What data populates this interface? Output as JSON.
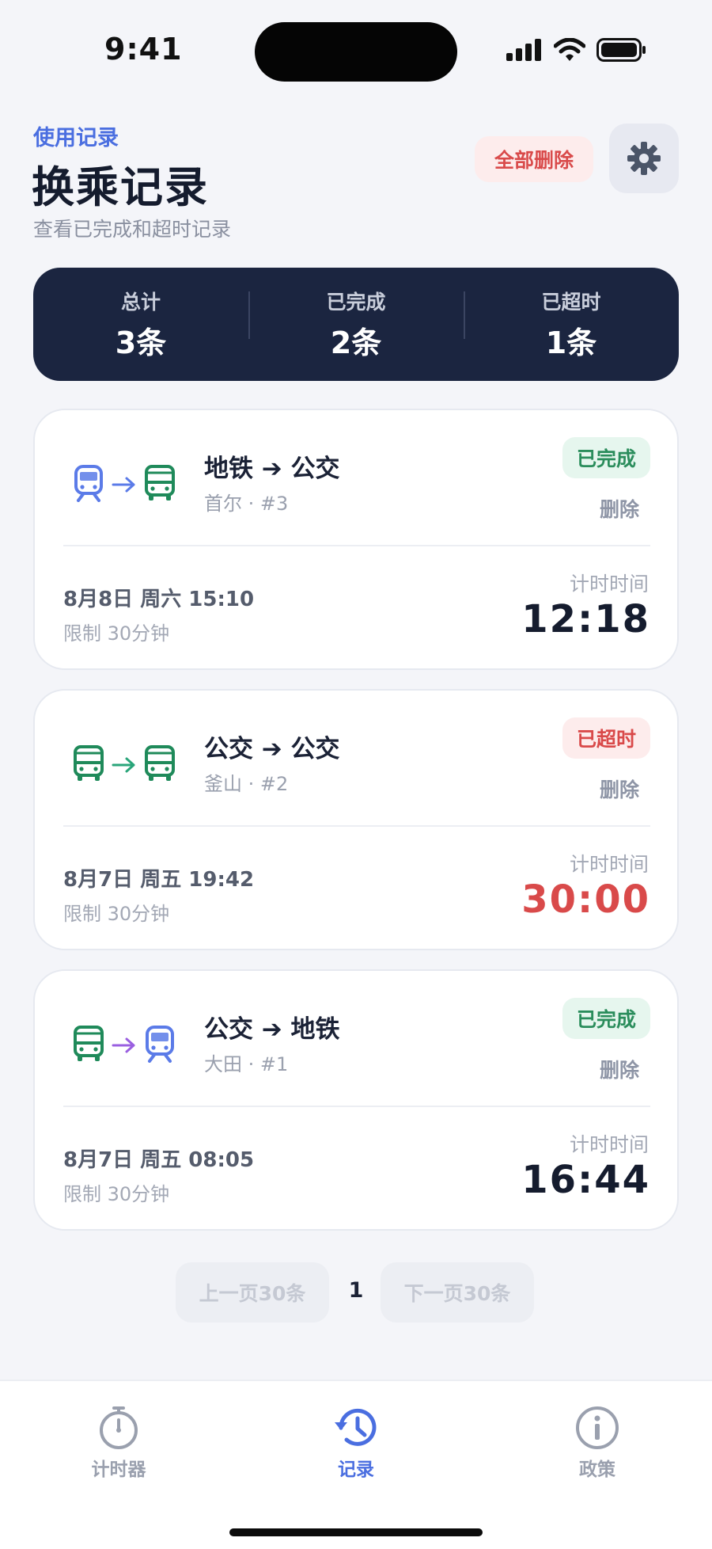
{
  "status": {
    "time": "9:41"
  },
  "header": {
    "eyebrow": "使用记录",
    "title": "换乘记录",
    "subtitle": "查看已完成和超时记录",
    "delete_all": "全部删除"
  },
  "summary": [
    {
      "label": "总计",
      "value": "3条"
    },
    {
      "label": "已完成",
      "value": "2条"
    },
    {
      "label": "已超时",
      "value": "1条"
    }
  ],
  "records": [
    {
      "from_icon": "subway-icon",
      "to_icon": "bus-icon",
      "route": "地铁 ➔ 公交",
      "sub": "首尔 · #3",
      "status": "已完成",
      "status_type": "ok",
      "delete": "删除",
      "date": "8月8日 周六 15:10",
      "limit": "限制 30分钟",
      "timer_label": "计时时间",
      "timer": "12:18"
    },
    {
      "from_icon": "bus-icon",
      "to_icon": "bus-icon",
      "route": "公交 ➔ 公交",
      "sub": "釜山 · #2",
      "status": "已超时",
      "status_type": "over",
      "delete": "删除",
      "date": "8月7日 周五 19:42",
      "limit": "限制 30分钟",
      "timer_label": "计时时间",
      "timer": "30:00"
    },
    {
      "from_icon": "bus-icon",
      "to_icon": "subway-icon",
      "route": "公交 ➔ 地铁",
      "sub": "大田 · #1",
      "status": "已完成",
      "status_type": "ok",
      "delete": "删除",
      "date": "8月7日 周五 08:05",
      "limit": "限制 30分钟",
      "timer_label": "计时时间",
      "timer": "16:44"
    }
  ],
  "pager": {
    "prev": "上一页30条",
    "page": "1",
    "next": "下一页30条"
  },
  "tabs": [
    {
      "label": "计时器",
      "icon": "stopwatch-icon"
    },
    {
      "label": "记录",
      "icon": "history-icon",
      "active": true
    },
    {
      "label": "政策",
      "icon": "info-icon"
    }
  ],
  "colors": {
    "accent": "#4a6ee0",
    "subway": "#5b7be8",
    "bus": "#1f8a5a",
    "danger": "#d94a4a",
    "summary_bg": "#1b2540"
  }
}
